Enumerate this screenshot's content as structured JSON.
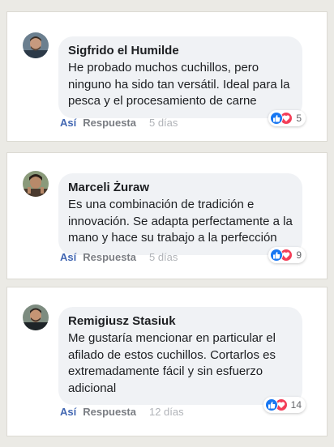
{
  "comments": [
    {
      "author": "Sigfrido el Humilde",
      "text": "He probado muchos cuchillos, pero ninguno ha sido tan versátil. Ideal para la pesca y el procesamiento de carne",
      "reaction_count": "5",
      "like_label": "Así",
      "reply_label": "Respuesta",
      "time": "5 días"
    },
    {
      "author": "Marceli Żuraw",
      "text": "Es una combinación de tradición e innovación. Se adapta perfectamente a la mano y hace su trabajo a la perfección",
      "reaction_count": "9",
      "like_label": "Así",
      "reply_label": "Respuesta",
      "time": "5 días"
    },
    {
      "author": "Remigiusz Stasiuk",
      "text": "Me gustaría mencionar en particular el afilado de estos cuchillos. Cortarlos es extremadamente fácil y sin esfuerzo adicional",
      "reaction_count": "14",
      "like_label": "Así",
      "reply_label": "Respuesta",
      "time": "12 días"
    }
  ],
  "colors": {
    "like_blue": "#1877f2",
    "love_red": "#f33e58",
    "action_blue": "#4267b2",
    "bubble": "#f0f2f5",
    "background": "#ebeae5"
  },
  "icons": [
    "avatar",
    "like-reaction-icon",
    "love-reaction-icon"
  ]
}
